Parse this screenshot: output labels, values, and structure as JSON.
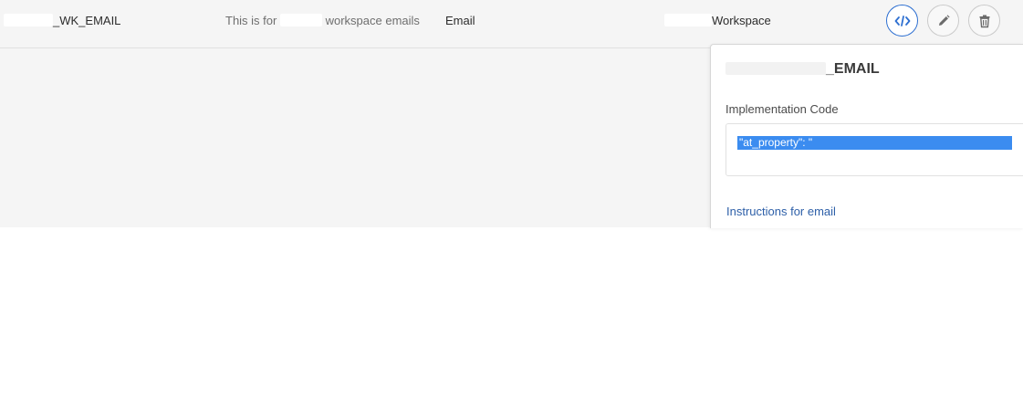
{
  "row": {
    "name": "_WK_EMAIL",
    "description_prefix": "This is for",
    "description_suffix": "workspace emails",
    "channel": "Email",
    "workspace": "Workspace"
  },
  "actions": {
    "code_icon": "code-icon",
    "edit_icon": "pencil-icon",
    "delete_icon": "trash-icon"
  },
  "popover": {
    "title": "_EMAIL",
    "implementation_label": "Implementation Code",
    "code_value": "\"at_property\": \"",
    "link_text": "Instructions for email"
  },
  "colors": {
    "accent": "#2d6fd1",
    "selection": "#3b8cf0",
    "link": "#2d5fa8"
  }
}
